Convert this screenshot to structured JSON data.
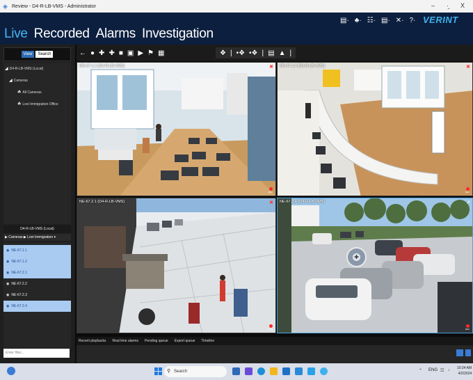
{
  "window": {
    "title": "Review - D4-R-LB-VMS - Administrator",
    "minimize": "–",
    "maximize": "·̱",
    "close": "X"
  },
  "nav": {
    "tabs": [
      "Live",
      "Recorded",
      "Alarms",
      "Investigation"
    ],
    "active": "Live"
  },
  "brand": {
    "logo": "VERINT"
  },
  "header_icons": [
    "▤·",
    "♣·",
    "☷·",
    "▤·",
    "✕·",
    "?·"
  ],
  "left": {
    "view_btn": "View",
    "search_btn": "Search",
    "tree": [
      {
        "icon": "◢",
        "label": "D4-R-LB-VMS (Local)"
      },
      {
        "icon": "◢",
        "label": "Cameras"
      },
      {
        "icon": "☘",
        "label": "All Cameras"
      },
      {
        "icon": "☘",
        "label": "Loei Immigration Office"
      }
    ],
    "site_header": "D4-R-LB-VMS (Local)",
    "breadcrumb": "▶ Cameras ▶ Loei Immigration ▾",
    "cameras": [
      {
        "label": "NE-67.1.1",
        "selected": true
      },
      {
        "label": "NE-67.1.2",
        "selected": true
      },
      {
        "label": "NE-67.2.1",
        "selected": true
      },
      {
        "label": "NE-67.2.2",
        "selected": false
      },
      {
        "label": "NE-67.2.3",
        "selected": false
      },
      {
        "label": "NE-67.2.4",
        "selected": true
      }
    ],
    "filter_placeholder": "Enter filter..."
  },
  "toolbar": {
    "left_icons": [
      "←",
      "●",
      "✚",
      "✚",
      "■",
      "▣",
      "▶",
      "⚑",
      "▦"
    ],
    "right_icons": [
      "❖",
      "|",
      "•❖",
      "•❖",
      "|",
      "▤",
      "▲",
      "|"
    ]
  },
  "tiles": [
    {
      "label": "NE-67.1.1 (D4-R-LB-VMS)",
      "rec": "REC"
    },
    {
      "label": "NE-67.1.2 (D4-R-LB-VMS)",
      "rec": "REC"
    },
    {
      "label": "NE-67.2.1 (D4-R-LB-VMS)",
      "rec": "REC"
    },
    {
      "label": "NE-67.2.4 (D4-R-LB-VMS)",
      "rec": "REC"
    }
  ],
  "bottom_tabs": [
    "Recent playbacks",
    "Real time alarms",
    "Pending queue",
    "Export queue",
    "Timeline"
  ],
  "taskbar": {
    "search_placeholder": "Search",
    "lang": "ENG",
    "time": "10:24 AM",
    "date": "4/2/2024"
  },
  "colors": {
    "accent": "#47b4ee",
    "header_bg": "#0c1f3f",
    "selection": "#a9cbf2",
    "record": "#ff2a2a"
  }
}
